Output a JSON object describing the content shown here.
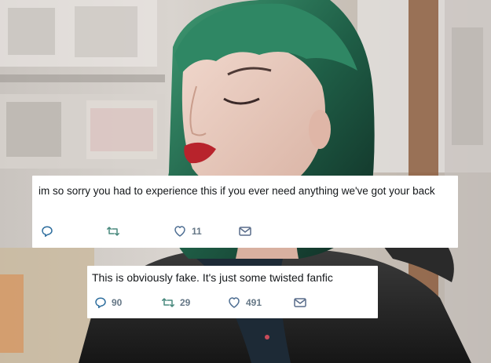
{
  "tweets": [
    {
      "text": "im so sorry you had to experience this if you ever need anything we've got your back",
      "replies": "",
      "retweets": "",
      "likes": "11"
    },
    {
      "text": "This is obviously fake. It's just some twisted fanfic",
      "replies": "90",
      "retweets": "29",
      "likes": "491"
    }
  ],
  "icons": {
    "reply": "reply-icon",
    "retweet": "retweet-icon",
    "like": "heart-icon",
    "dm": "envelope-icon"
  },
  "colors": {
    "card_background": "#ffffff",
    "tweet_text": "#14171a",
    "action_gray": "#657786",
    "hair_green": "#2e7a5c",
    "lips_red": "#b8232c"
  }
}
